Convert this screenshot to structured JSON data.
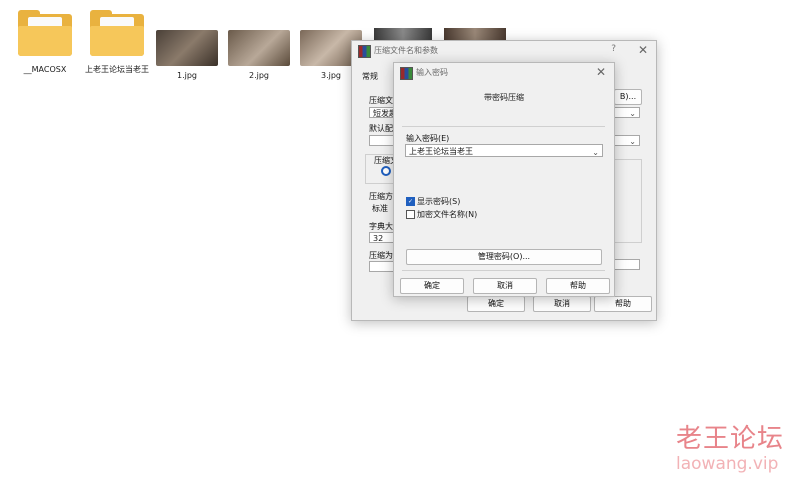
{
  "desktop": {
    "items": [
      {
        "name": "__MACOSX",
        "type": "folder"
      },
      {
        "name": "上老王论坛当老王",
        "type": "folder"
      },
      {
        "name": "1.jpg",
        "type": "image"
      },
      {
        "name": "2.jpg",
        "type": "image"
      },
      {
        "name": "3.jpg",
        "type": "image"
      }
    ]
  },
  "archive_dialog": {
    "title": "压缩文件名和参数",
    "help_symbol": "?",
    "tab_general": "常规",
    "label_archive_name": "压缩文",
    "archive_name_value": "短发趣",
    "browse_suffix": "B)...",
    "label_default_profile": "默认配",
    "label_archive_format": "压缩文",
    "label_compression_method": "压缩方",
    "compression_method_value": "标准",
    "label_dictionary_size": "字典大",
    "dictionary_size_value": "32",
    "label_split_volumes": "压缩为",
    "ok_button": "确定",
    "cancel_button": "取消",
    "help_button": "帮助"
  },
  "password_dialog": {
    "title": "输入密码",
    "heading": "带密码压缩",
    "password_label": "输入密码(E)",
    "password_value": "上老王论坛当老王",
    "show_password_label": "显示密码(S)",
    "show_password_checked": true,
    "encrypt_filenames_label": "加密文件名称(N)",
    "encrypt_filenames_checked": false,
    "manage_passwords_button": "管理密码(O)...",
    "ok_button": "确定",
    "cancel_button": "取消",
    "help_button": "帮助"
  },
  "watermark": {
    "text_cn": "老王论坛",
    "text_en": "laowang.vip"
  },
  "colors": {
    "folder": "#e9b23f",
    "accent": "#1f5fbf",
    "watermark": "#e8848a"
  }
}
